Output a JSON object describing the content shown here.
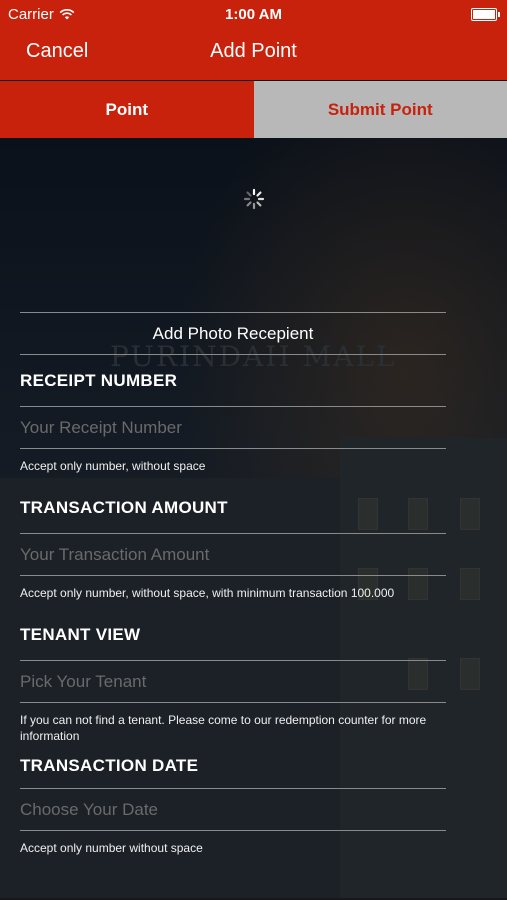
{
  "status_bar": {
    "carrier": "Carrier",
    "time": "1:00 AM"
  },
  "nav": {
    "cancel_label": "Cancel",
    "title": "Add Point"
  },
  "tabs": [
    {
      "label": "Point",
      "active": true
    },
    {
      "label": "Submit Point",
      "active": false
    }
  ],
  "form": {
    "add_photo_label": "Add Photo Recepient",
    "sections": [
      {
        "title": "RECEIPT NUMBER",
        "placeholder": "Your Receipt Number",
        "value": "",
        "note": "Accept only number, without space"
      },
      {
        "title": "TRANSACTION AMOUNT",
        "placeholder": "Your Transaction Amount",
        "value": "",
        "note": "Accept only number, without space, with minimum transaction 100.000"
      },
      {
        "title": "TENANT VIEW",
        "placeholder": "Pick Your Tenant",
        "value": "",
        "note": "If you can not find a tenant. Please come to our redemption counter for more information"
      },
      {
        "title": "TRANSACTION DATE",
        "placeholder": "Choose Your Date",
        "value": "",
        "note": "Accept only number without space"
      }
    ]
  },
  "colors": {
    "brand_red": "#c8210c",
    "tab_inactive": "#b8b8b8"
  },
  "icons": {
    "wifi": "wifi-icon",
    "battery": "battery-icon",
    "spinner": "loading-spinner-icon"
  }
}
